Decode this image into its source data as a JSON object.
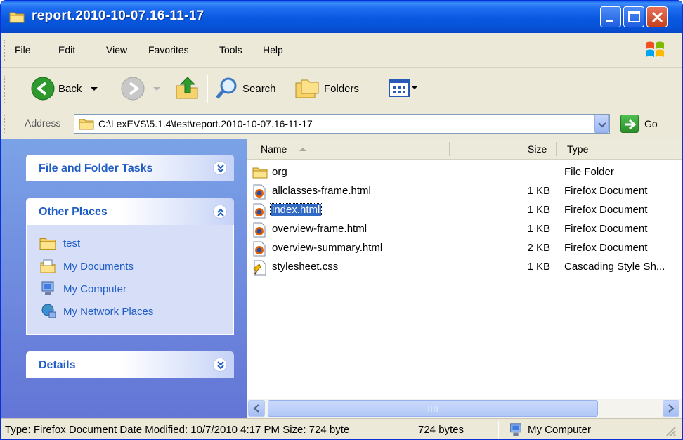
{
  "window": {
    "title": "report.2010-10-07.16-11-17"
  },
  "menu": [
    "File",
    "Edit",
    "View",
    "Favorites",
    "Tools",
    "Help"
  ],
  "toolbar": {
    "back_label": "Back",
    "search_label": "Search",
    "folders_label": "Folders"
  },
  "address": {
    "label": "Address",
    "value": "C:\\LexEVS\\5.1.4\\test\\report.2010-10-07.16-11-17",
    "go_label": "Go"
  },
  "tasks": {
    "file_folder_tasks": "File and Folder Tasks",
    "other_places": "Other Places",
    "places": [
      {
        "label": "test",
        "icon": "folder-icon"
      },
      {
        "label": "My Documents",
        "icon": "my-documents-icon"
      },
      {
        "label": "My Computer",
        "icon": "my-computer-icon"
      },
      {
        "label": "My Network Places",
        "icon": "network-places-icon"
      }
    ],
    "details": "Details"
  },
  "columns": {
    "name": "Name",
    "size": "Size",
    "type": "Type"
  },
  "files": [
    {
      "name": "org",
      "size": "",
      "type": "File Folder",
      "icon": "folder-icon"
    },
    {
      "name": "allclasses-frame.html",
      "size": "1 KB",
      "type": "Firefox Document",
      "icon": "firefox-document-icon"
    },
    {
      "name": "index.html",
      "size": "1 KB",
      "type": "Firefox Document",
      "icon": "firefox-document-icon",
      "selected": true
    },
    {
      "name": "overview-frame.html",
      "size": "1 KB",
      "type": "Firefox Document",
      "icon": "firefox-document-icon"
    },
    {
      "name": "overview-summary.html",
      "size": "2 KB",
      "type": "Firefox Document",
      "icon": "firefox-document-icon"
    },
    {
      "name": "stylesheet.css",
      "size": "1 KB",
      "type": "Cascading Style Sh...",
      "icon": "css-file-icon"
    }
  ],
  "status": {
    "info": "Type: Firefox Document Date Modified: 10/7/2010 4:17 PM Size: 724 byte",
    "size": "724 bytes",
    "zone": "My Computer"
  },
  "colors": {
    "title_blue": "#0a58e0",
    "task_link": "#215dc6",
    "selection": "#316ac5"
  }
}
